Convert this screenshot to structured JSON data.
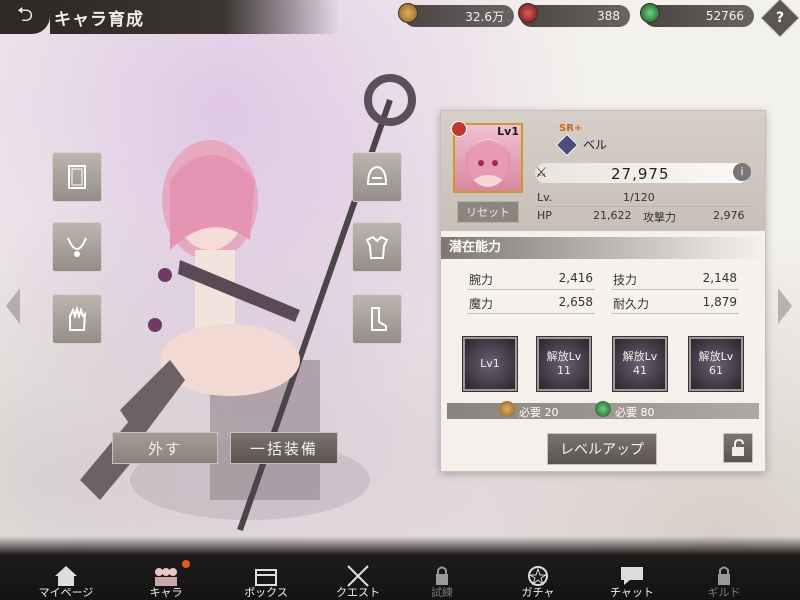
{
  "header": {
    "title": "キャラ育成",
    "back_icon": "back-arrow-icon"
  },
  "currencies": [
    {
      "icon": "gold-coin-icon",
      "value": "32.6万",
      "color": "#b8873f"
    },
    {
      "icon": "red-gem-icon",
      "value": "388",
      "color": "#b8322f"
    },
    {
      "icon": "green-orb-icon",
      "value": "52766",
      "color": "#3a8a4a"
    }
  ],
  "help_label": "?",
  "equipment_slots": {
    "left": [
      "card-icon",
      "necklace-icon",
      "glove-icon"
    ],
    "right": [
      "helmet-icon",
      "armor-icon",
      "boot-icon"
    ]
  },
  "buttons": {
    "unequip": "外す",
    "equip_all": "一括装備",
    "reset": "リセット",
    "level_up": "レベルアップ"
  },
  "character": {
    "rarity": "SR+",
    "name": "ベル",
    "portrait_level": "Lv1",
    "power": "27,975",
    "lv_label": "Lv.",
    "lv_value": "1/120",
    "hp_label": "HP",
    "hp_value": "21,622",
    "atk_label": "攻撃力",
    "atk_value": "2,976",
    "info_label": "i"
  },
  "potential": {
    "title": "潜在能力",
    "stats": [
      {
        "label": "腕力",
        "value": "2,416"
      },
      {
        "label": "技力",
        "value": "2,148"
      },
      {
        "label": "魔力",
        "value": "2,658"
      },
      {
        "label": "耐久力",
        "value": "1,879"
      }
    ],
    "skills": [
      {
        "line1": "",
        "line2": "Lv1"
      },
      {
        "line1": "解放Lv",
        "line2": "11"
      },
      {
        "line1": "解放Lv",
        "line2": "41"
      },
      {
        "line1": "解放Lv",
        "line2": "61"
      }
    ],
    "requirements": [
      {
        "icon": "gold-coin-icon",
        "label": "必要 20"
      },
      {
        "icon": "green-orb-icon",
        "label": "必要 80"
      }
    ]
  },
  "nav": [
    {
      "label": "マイページ",
      "icon": "home-icon",
      "locked": false
    },
    {
      "label": "キャラ",
      "icon": "character-icon",
      "locked": false,
      "badge": true
    },
    {
      "label": "ボックス",
      "icon": "box-icon",
      "locked": false
    },
    {
      "label": "クエスト",
      "icon": "crossed-swords-icon",
      "locked": false
    },
    {
      "label": "試練",
      "icon": "lock-icon",
      "locked": true
    },
    {
      "label": "ガチャ",
      "icon": "gacha-icon",
      "locked": false
    },
    {
      "label": "チャット",
      "icon": "chat-icon",
      "locked": false
    },
    {
      "label": "ギルド",
      "icon": "lock-icon",
      "locked": true
    }
  ]
}
